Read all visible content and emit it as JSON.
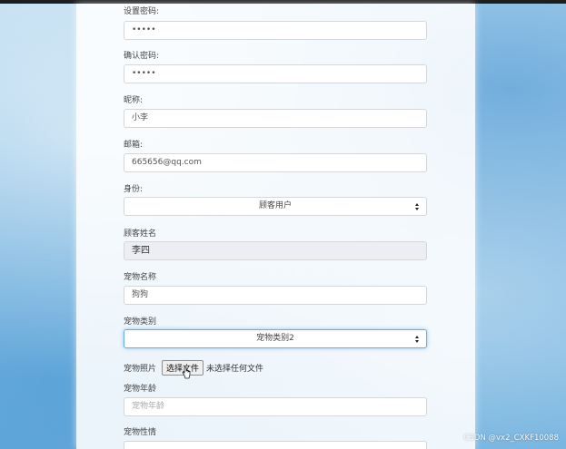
{
  "form": {
    "set_password": {
      "label": "设置密码:",
      "value": "•••••"
    },
    "confirm_password": {
      "label": "确认密码:",
      "value": "•••••"
    },
    "nickname": {
      "label": "昵称:",
      "value": "小李"
    },
    "email": {
      "label": "邮箱:",
      "value": "665656@qq.com"
    },
    "identity": {
      "label": "身份:",
      "selected": "顾客用户"
    },
    "customer_name": {
      "label": "顾客姓名",
      "value": "李四"
    },
    "pet_name": {
      "label": "宠物名称",
      "value": "狗狗"
    },
    "pet_category": {
      "label": "宠物类别",
      "selected": "宠物类别2"
    },
    "pet_photo": {
      "label": "宠物照片",
      "button": "选择文件",
      "status": "未选择任何文件"
    },
    "pet_age": {
      "label": "宠物年龄",
      "placeholder": "宠物年龄"
    },
    "pet_temperament": {
      "label": "宠物性情"
    }
  },
  "watermark": "CSDN @vx2_CXKF10088",
  "colors": {
    "focus_border": "#66afe9",
    "readonly_bg": "#eceef4"
  },
  "icons": {
    "select_caret": "updown-caret-icon",
    "cursor": "hand-pointer-icon"
  }
}
